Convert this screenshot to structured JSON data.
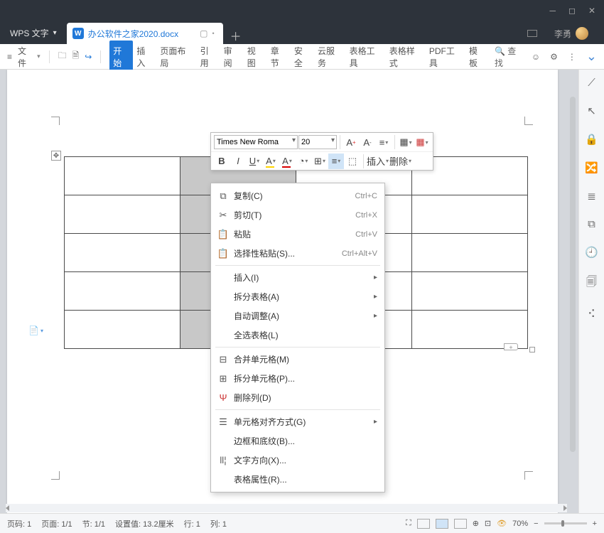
{
  "app": {
    "name": "WPS 文字",
    "user": "李勇"
  },
  "tabs": {
    "doc_name": "办公软件之家2020.docx"
  },
  "ribbon": {
    "file": "文件",
    "items": [
      "开始",
      "插入",
      "页面布局",
      "引用",
      "审阅",
      "视图",
      "章节",
      "安全",
      "云服务",
      "表格工具",
      "表格样式",
      "PDF工具",
      "模板"
    ],
    "search": "查找"
  },
  "mini": {
    "font": "Times New Roma",
    "size": "20",
    "insert": "插入",
    "delete": "删除"
  },
  "menu": {
    "copy": "复制(C)",
    "copy_k": "Ctrl+C",
    "cut": "剪切(T)",
    "cut_k": "Ctrl+X",
    "paste": "粘贴",
    "paste_k": "Ctrl+V",
    "paste_special": "选择性粘贴(S)...",
    "paste_special_k": "Ctrl+Alt+V",
    "insert": "插入(I)",
    "split_table": "拆分表格(A)",
    "autofit": "自动调整(A)",
    "select_all": "全选表格(L)",
    "merge": "合并单元格(M)",
    "split_cell": "拆分单元格(P)...",
    "del_col": "删除列(D)",
    "align": "单元格对齐方式(G)",
    "border": "边框和底纹(B)...",
    "direction": "文字方向(X)...",
    "props": "表格属性(R)..."
  },
  "status": {
    "page_no": "页码: 1",
    "page_of": "页面: 1/1",
    "section": "节: 1/1",
    "setting": "设置值: 13.2厘米",
    "line": "行: 1",
    "col": "列: 1",
    "zoom": "70%"
  }
}
